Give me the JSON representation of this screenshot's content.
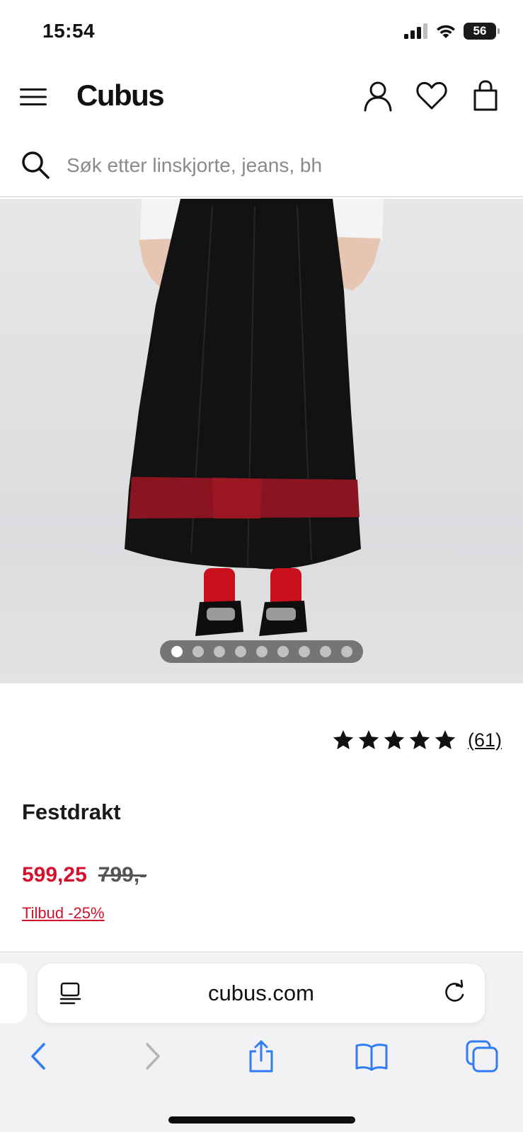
{
  "status_bar": {
    "time": "15:54",
    "battery": "56"
  },
  "header": {
    "logo": "Cubus"
  },
  "search": {
    "placeholder": "Søk etter linskjorte, jeans, bh"
  },
  "carousel": {
    "total": 9,
    "active": 1
  },
  "product": {
    "rating": {
      "stars": 5,
      "count": "(61)"
    },
    "name": "Festdrakt",
    "price_sale": "599,25",
    "price_original": "799,-",
    "offer": "Tilbud -25%"
  },
  "browser": {
    "url": "cubus.com"
  },
  "colors": {
    "sale_red": "#d3102d",
    "safari_blue": "#2f7cf6"
  }
}
